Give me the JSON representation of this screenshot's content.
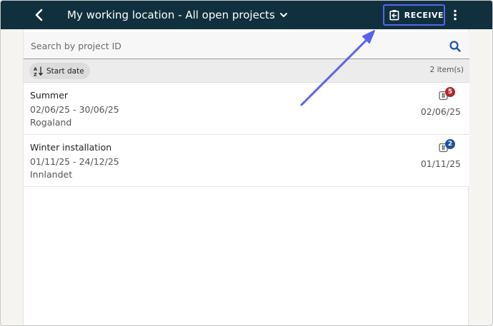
{
  "header": {
    "title": "My working location - All open projects",
    "receive_label": "RECEIVE",
    "icons": {
      "back": "chevron-left-icon",
      "title_dropdown": "chevron-down-icon",
      "receive": "clipboard-arrow-icon",
      "more": "more-vertical-icon"
    }
  },
  "search": {
    "placeholder": "Search by project ID",
    "value": ""
  },
  "sort": {
    "label": "Start date",
    "icon": "sort-alpha-icon",
    "count": "2 item(s)"
  },
  "projects": [
    {
      "name": "Summer",
      "dates": "02/06/25 - 30/06/25",
      "region": "Rogaland",
      "date": "02/06/25",
      "badge": "5",
      "badge_color": "#b3262d"
    },
    {
      "name": "Winter installation",
      "dates": "01/11/25 - 24/12/25",
      "region": "Innlandet",
      "date": "01/11/25",
      "badge": "2",
      "badge_color": "#1e4fa3"
    }
  ],
  "colors": {
    "header_bg": "#10303d",
    "accent_blue": "#1a4fb0",
    "annotation": "#5a63f0"
  }
}
